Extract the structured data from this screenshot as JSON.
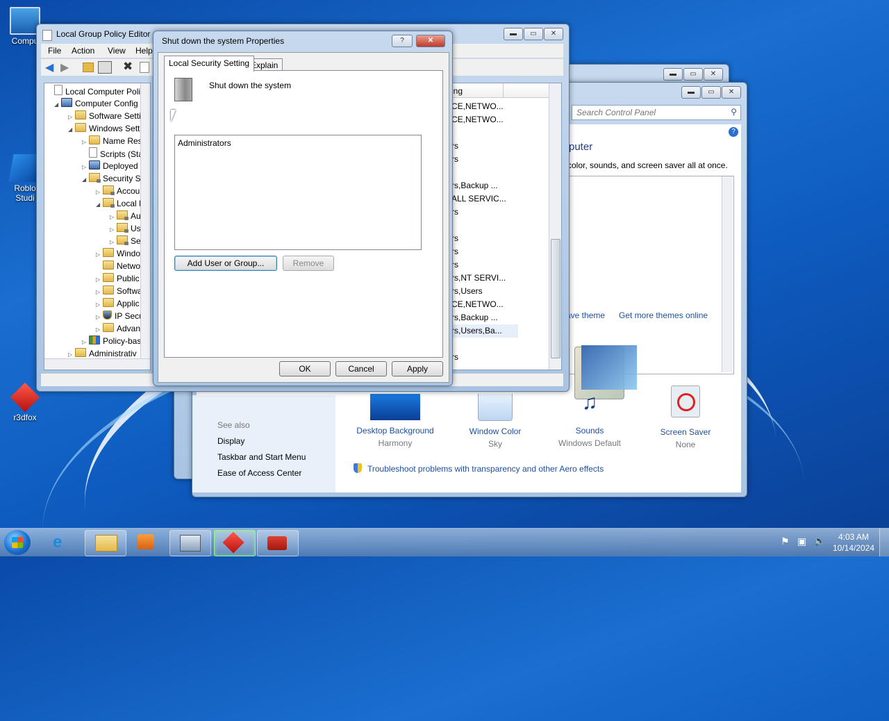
{
  "desktop": {
    "icons": [
      {
        "label": "Compu"
      },
      {
        "label": "Roblo\nStudi"
      },
      {
        "label": "r3dfox"
      }
    ]
  },
  "gpedit": {
    "title": "Local Group Policy Editor",
    "menu": [
      "File",
      "Action",
      "View",
      "Help"
    ],
    "tree": [
      {
        "label": "Local Computer Polic",
        "toggle": ""
      },
      {
        "label": "Computer Config",
        "toggle": "◢"
      },
      {
        "label": "Software Setti",
        "toggle": "▷"
      },
      {
        "label": "Windows Sett",
        "toggle": "◢"
      },
      {
        "label": "Name Res",
        "toggle": "▷"
      },
      {
        "label": "Scripts (Sta",
        "toggle": ""
      },
      {
        "label": "Deployed",
        "toggle": "▷"
      },
      {
        "label": "Security Se",
        "toggle": "◢"
      },
      {
        "label": "Accou",
        "toggle": "▷"
      },
      {
        "label": "Local P",
        "toggle": "◢"
      },
      {
        "label": "Au",
        "toggle": "▷"
      },
      {
        "label": "Use",
        "toggle": "▷"
      },
      {
        "label": "Sec",
        "toggle": "▷"
      },
      {
        "label": "Windo",
        "toggle": "▷"
      },
      {
        "label": "Netwo",
        "toggle": ""
      },
      {
        "label": "Public",
        "toggle": "▷"
      },
      {
        "label": "Softwa",
        "toggle": "▷"
      },
      {
        "label": "Applic",
        "toggle": "▷"
      },
      {
        "label": "IP Secu",
        "toggle": "▷"
      },
      {
        "label": "Advan",
        "toggle": "▷"
      },
      {
        "label": "Policy-bas",
        "toggle": "▷"
      },
      {
        "label": "Administrativ",
        "toggle": "▷"
      }
    ],
    "list_header": "ing",
    "list_rows": [
      {
        "text": "CE,NETWO...",
        "y": 0
      },
      {
        "text": "CE,NETWO...",
        "y": 1
      },
      {
        "text": "rs",
        "y": 3
      },
      {
        "text": "rs",
        "y": 4
      },
      {
        "text": "rs,Backup ...",
        "y": 6
      },
      {
        "text": "ALL SERVIC...",
        "y": 7
      },
      {
        "text": "rs",
        "y": 8
      },
      {
        "text": "rs",
        "y": 10
      },
      {
        "text": "rs",
        "y": 11
      },
      {
        "text": "rs",
        "y": 12
      },
      {
        "text": "rs,NT SERVI...",
        "y": 13
      },
      {
        "text": "rs,Users",
        "y": 14
      },
      {
        "text": "CE,NETWO...",
        "y": 15
      },
      {
        "text": "rs,Backup ...",
        "y": 16
      },
      {
        "text": "rs,Users,Ba...",
        "y": 17
      },
      {
        "text": "rs",
        "y": 19
      }
    ]
  },
  "control_panel": {
    "search_placeholder": "Search Control Panel",
    "heading": "puter",
    "subtext": "color, sounds, and screen saver all at once.",
    "save_theme": "ave theme",
    "get_more": "Get more themes online",
    "see_also": "See also",
    "see_also_links": [
      "Display",
      "Taskbar and Start Menu",
      "Ease of Access Center"
    ],
    "items": [
      {
        "label": "Desktop Background",
        "value": "Harmony"
      },
      {
        "label": "Window Color",
        "value": "Sky"
      },
      {
        "label": "Sounds",
        "value": "Windows Default"
      },
      {
        "label": "Screen Saver",
        "value": "None"
      }
    ],
    "troubleshoot": "Troubleshoot problems with transparency and other Aero effects"
  },
  "dialog": {
    "title": "Shut down the system Properties",
    "help": "?",
    "close": "✕",
    "tabs": [
      "Local Security Setting",
      "Explain"
    ],
    "policy_name": "Shut down the system",
    "members": [
      "Administrators"
    ],
    "add_button": "Add User or Group...",
    "remove_button": "Remove",
    "ok": "OK",
    "cancel": "Cancel",
    "apply": "Apply"
  },
  "taskbar": {
    "time": "4:03 AM",
    "date": "10/14/2024"
  }
}
